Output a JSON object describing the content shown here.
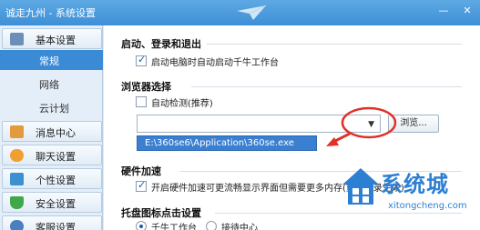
{
  "window": {
    "title": "诚走九州 - 系统设置",
    "controls": {
      "minimize": "—",
      "close": "✕"
    }
  },
  "sidebar": {
    "groups": [
      {
        "label": "基本设置",
        "icon": "settings-icon",
        "color": "#6b8fb8"
      },
      {
        "label": "消息中心",
        "icon": "mail-icon",
        "color": "#e39a3c"
      },
      {
        "label": "聊天设置",
        "icon": "chat-icon",
        "color": "#f0a030"
      },
      {
        "label": "个性设置",
        "icon": "palette-icon",
        "color": "#3c8fd0"
      },
      {
        "label": "安全设置",
        "icon": "shield-icon",
        "color": "#3fa84a"
      },
      {
        "label": "客服设置",
        "icon": "headset-icon",
        "color": "#4a7fc0"
      }
    ],
    "subitems": [
      {
        "label": "常规",
        "active": true
      },
      {
        "label": "网络",
        "active": false
      },
      {
        "label": "云计划",
        "active": false
      }
    ]
  },
  "content": {
    "startup": {
      "title": "启动、登录和退出",
      "option": {
        "label": "启动电脑时自动启动千牛工作台",
        "checked": true
      }
    },
    "browser": {
      "title": "浏览器选择",
      "auto_detect": {
        "label": "自动检测(推荐)",
        "checked": false
      },
      "combo_value": "",
      "browse_label": "浏览...",
      "dropdown_option": "E:\\360se6\\Application\\360se.exe"
    },
    "hardware": {
      "title": "硬件加速",
      "option": {
        "label": "开启硬件加速可更流畅显示界面但需要更多内存(重启登录生效)",
        "checked": true
      }
    },
    "tray": {
      "title": "托盘图标点击设置",
      "options": [
        {
          "label": "千牛工作台",
          "checked": true
        },
        {
          "label": "接待中心",
          "checked": false
        }
      ]
    }
  },
  "watermark": {
    "brand": "系统城",
    "url": "xitongcheng.com"
  },
  "colors": {
    "titlebar": "#3d8fd6",
    "active_nav": "#3b8ad6",
    "annotation": "#e0302a",
    "dropdown_highlight": "#3b7fd0",
    "watermark": "#2d7fd3"
  }
}
